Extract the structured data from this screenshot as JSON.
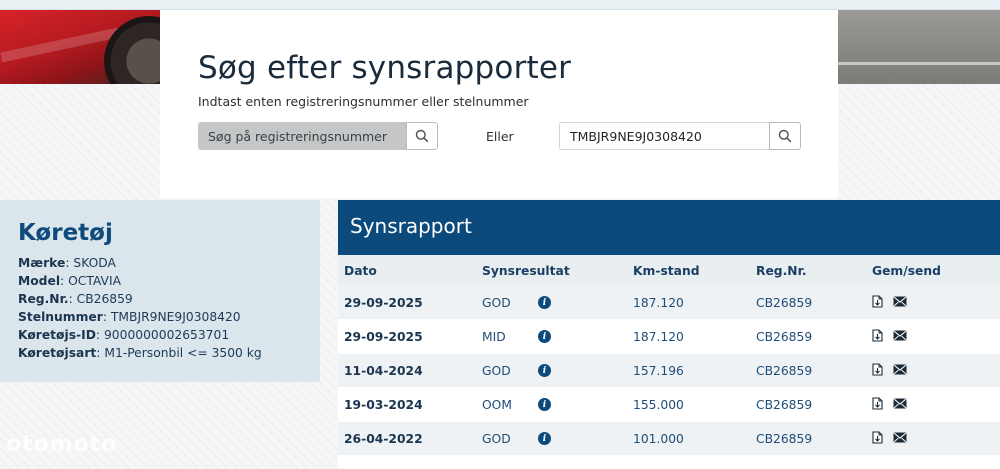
{
  "hero": {
    "title": "Søg efter synsrapporter",
    "subtitle": "Indtast enten registreringsnummer eller stelnummer",
    "reg_search": {
      "placeholder": "Søg på registreringsnummer",
      "value": ""
    },
    "or_label": "Eller",
    "vin_search": {
      "placeholder": "",
      "value": "TMBJR9NE9J0308420"
    }
  },
  "vehicle": {
    "heading": "Køretøj",
    "fields": [
      {
        "label": "Mærke",
        "value": ": SKODA"
      },
      {
        "label": "Model",
        "value": ": OCTAVIA"
      },
      {
        "label": "Reg.Nr.",
        "value": ": CB26859"
      },
      {
        "label": "Stelnummer",
        "value": ": TMBJR9NE9J0308420"
      },
      {
        "label": "Køretøjs-ID",
        "value": ": 9000000002653701"
      },
      {
        "label": "Køretøjsart",
        "value": ": M1-Personbil <= 3500 kg"
      }
    ]
  },
  "report": {
    "heading": "Synsrapport",
    "columns": {
      "date": "Dato",
      "result": "Synsresultat",
      "km": "Km-stand",
      "reg": "Reg.Nr.",
      "save": "Gem/send"
    },
    "rows": [
      {
        "date": "29-09-2025",
        "result": "GOD",
        "km": "187.120",
        "reg": "CB26859"
      },
      {
        "date": "29-09-2025",
        "result": "MID",
        "km": "187.120",
        "reg": "CB26859"
      },
      {
        "date": "11-04-2024",
        "result": "GOD",
        "km": "157.196",
        "reg": "CB26859"
      },
      {
        "date": "19-03-2024",
        "result": "OOM",
        "km": "155.000",
        "reg": "CB26859"
      },
      {
        "date": "26-04-2022",
        "result": "GOD",
        "km": "101.000",
        "reg": "CB26859"
      }
    ]
  },
  "watermark": "otomoto",
  "icons": {
    "search": "search-icon",
    "info": "info-icon",
    "download": "download-file-icon",
    "mail": "send-mail-icon"
  },
  "colors": {
    "brand": "#0c4a7c",
    "vehicle_panel": "#dbe5ec",
    "table_header": "#e9eef1"
  }
}
